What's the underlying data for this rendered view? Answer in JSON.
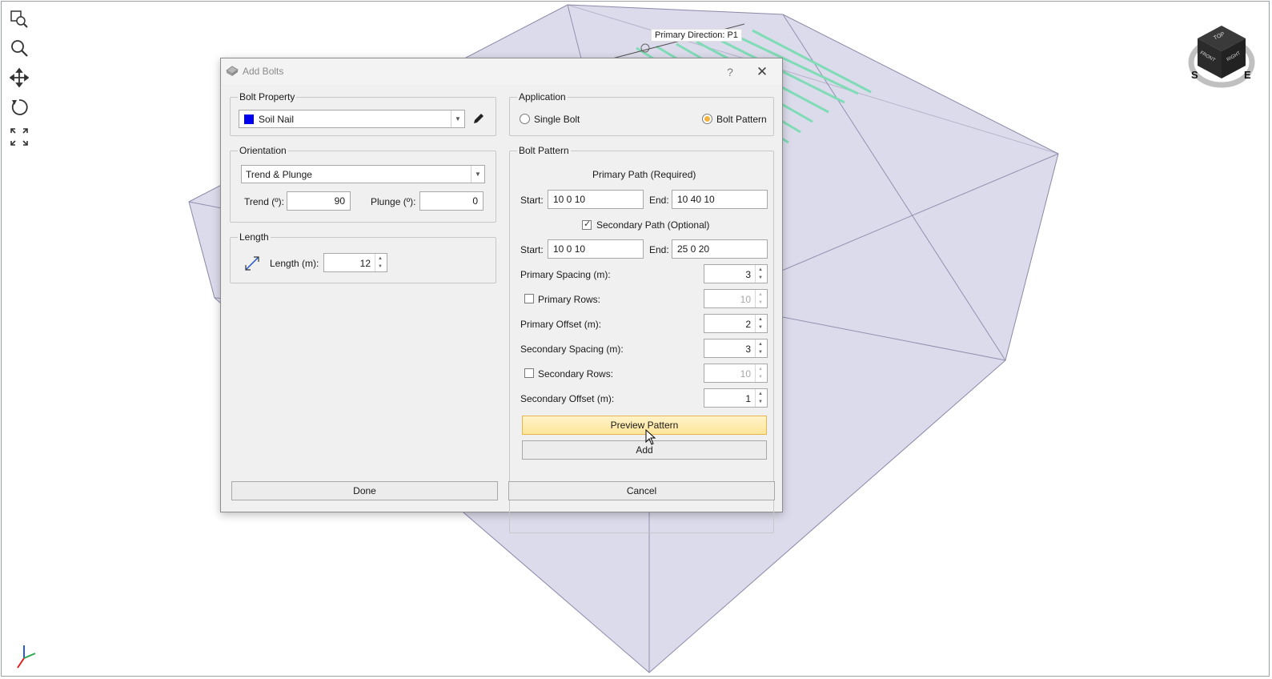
{
  "viewport": {
    "direction_label": "Primary Direction: P1",
    "view_cube": {
      "top": "TOP",
      "front": "FRONT",
      "right": "RIGHT",
      "compass_s": "S",
      "compass_e": "E"
    },
    "toolbar_icons": [
      "zoom-window-icon",
      "zoom-icon",
      "pan-icon",
      "rotate-icon",
      "zoom-extents-icon"
    ],
    "colors": {
      "box_fill": "#dcdbeb",
      "box_edge": "#8a88a8",
      "bolt_color": "#7fdcb6"
    }
  },
  "dialog": {
    "title": "Add Bolts",
    "help_label": "?",
    "close_label": "✕",
    "bolt_property": {
      "legend": "Bolt Property",
      "selected": "Soil Nail",
      "swatch_color": "#0000ee"
    },
    "orientation": {
      "legend": "Orientation",
      "method": "Trend & Plunge",
      "trend_label": "Trend (º):",
      "trend_value": "90",
      "plunge_label": "Plunge (º):",
      "plunge_value": "0"
    },
    "length": {
      "legend": "Length",
      "label": "Length (m):",
      "value": "12"
    },
    "application": {
      "legend": "Application",
      "single_bolt": "Single Bolt",
      "bolt_pattern": "Bolt Pattern",
      "selected": "bolt_pattern"
    },
    "bolt_pattern": {
      "legend": "Bolt Pattern",
      "primary_path_heading": "Primary Path (Required)",
      "start_label": "Start:",
      "end_label": "End:",
      "primary_start": "10 0 10",
      "primary_end": "10 40 10",
      "secondary_path_label": "Secondary Path (Optional)",
      "secondary_path_checked": true,
      "secondary_start": "10 0 10",
      "secondary_end": "25 0 20",
      "primary_spacing_label": "Primary Spacing (m):",
      "primary_spacing": "3",
      "primary_rows_label": "Primary Rows:",
      "primary_rows": "10",
      "primary_offset_label": "Primary Offset (m):",
      "primary_offset": "2",
      "secondary_spacing_label": "Secondary Spacing (m):",
      "secondary_spacing": "3",
      "secondary_rows_label": "Secondary Rows:",
      "secondary_rows": "10",
      "secondary_offset_label": "Secondary Offset (m):",
      "secondary_offset": "1",
      "preview_button": "Preview Pattern",
      "add_button": "Add"
    },
    "done_button": "Done",
    "cancel_button": "Cancel"
  }
}
